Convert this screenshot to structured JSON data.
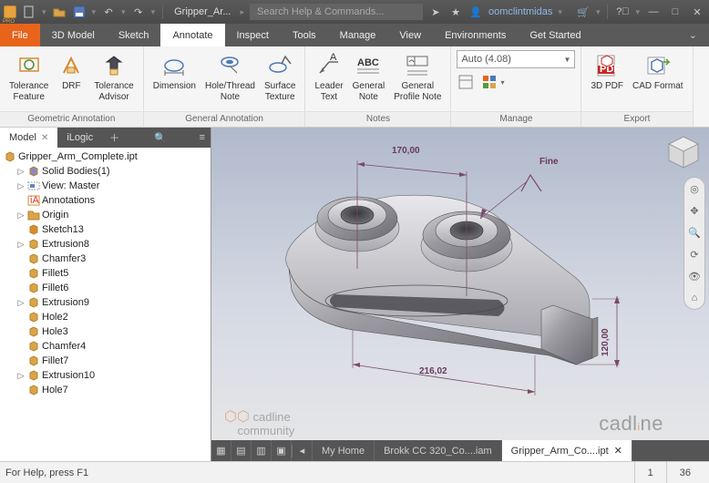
{
  "title": {
    "filename": "Gripper_Ar...",
    "search_placeholder": "Search Help & Commands...",
    "user": "oomclintmidas"
  },
  "menu": [
    "File",
    "3D Model",
    "Sketch",
    "Annotate",
    "Inspect",
    "Tools",
    "Manage",
    "View",
    "Environments",
    "Get Started"
  ],
  "menu_active": 3,
  "ribbon": {
    "panels": [
      {
        "title": "Geometric Annotation",
        "buttons": [
          {
            "n": "tolerance-feature",
            "l": "Tolerance\nFeature"
          },
          {
            "n": "drf",
            "l": "DRF"
          },
          {
            "n": "tolerance-advisor",
            "l": "Tolerance\nAdvisor"
          }
        ]
      },
      {
        "title": "General Annotation",
        "buttons": [
          {
            "n": "dimension",
            "l": "Dimension"
          },
          {
            "n": "hole-thread-note",
            "l": "Hole/Thread\nNote"
          },
          {
            "n": "surface-texture",
            "l": "Surface\nTexture"
          }
        ]
      },
      {
        "title": "Notes",
        "buttons": [
          {
            "n": "leader-text",
            "l": "Leader\nText"
          },
          {
            "n": "general-note",
            "l": "General\nNote"
          },
          {
            "n": "general-profile-note",
            "l": "General\nProfile Note"
          }
        ]
      },
      {
        "title": "Manage",
        "combo": "Auto (4.08)"
      },
      {
        "title": "Export",
        "buttons": [
          {
            "n": "3d-pdf",
            "l": "3D PDF"
          },
          {
            "n": "cad-format",
            "l": "CAD Format"
          }
        ]
      }
    ]
  },
  "browser": {
    "tabs": [
      "Model",
      "iLogic"
    ],
    "root": "Gripper_Arm_Complete.ipt",
    "nodes": [
      {
        "l": "Solid Bodies(1)",
        "i": "cube",
        "e": 1
      },
      {
        "l": "View: Master",
        "i": "view",
        "e": 1
      },
      {
        "l": "Annotations",
        "i": "ann",
        "e": 0
      },
      {
        "l": "Origin",
        "i": "folder",
        "e": 1
      },
      {
        "l": "Sketch13",
        "i": "sketch",
        "e": 0
      },
      {
        "l": "Extrusion8",
        "i": "ext",
        "e": 1
      },
      {
        "l": "Chamfer3",
        "i": "cham",
        "e": 0
      },
      {
        "l": "Fillet5",
        "i": "fil",
        "e": 0
      },
      {
        "l": "Fillet6",
        "i": "fil",
        "e": 0
      },
      {
        "l": "Extrusion9",
        "i": "ext",
        "e": 1
      },
      {
        "l": "Hole2",
        "i": "hole",
        "e": 0
      },
      {
        "l": "Hole3",
        "i": "hole",
        "e": 0
      },
      {
        "l": "Chamfer4",
        "i": "cham",
        "e": 0
      },
      {
        "l": "Fillet7",
        "i": "fil",
        "e": 0
      },
      {
        "l": "Extrusion10",
        "i": "ext",
        "e": 1
      },
      {
        "l": "Hole7",
        "i": "hole",
        "e": 0
      }
    ]
  },
  "viewport": {
    "dims": {
      "d1": "170,00",
      "d2": "216,02",
      "d3": "120,00",
      "note": "Fine"
    },
    "doctabs": [
      "My Home",
      "Brokk CC 320_Co....iam",
      "Gripper_Arm_Co....ipt"
    ],
    "doctab_active": 2
  },
  "status": {
    "msg": "For Help, press F1",
    "a": "1",
    "b": "36"
  }
}
